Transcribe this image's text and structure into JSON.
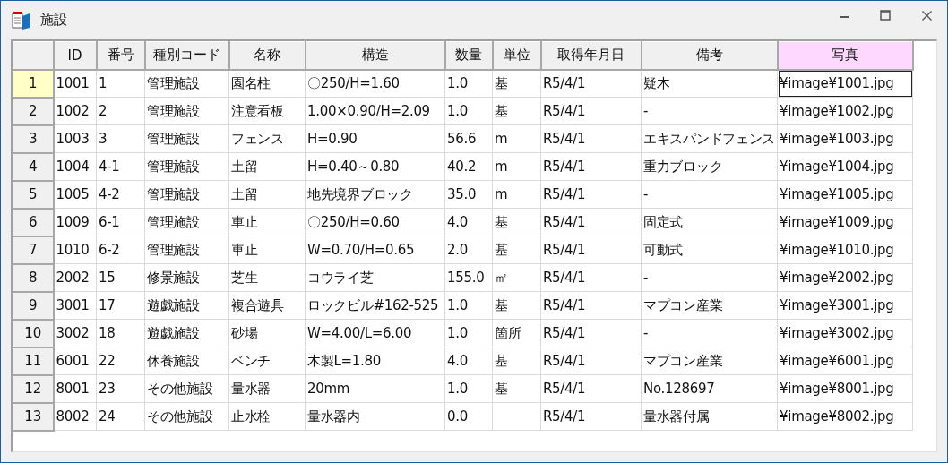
{
  "window": {
    "title": "施設"
  },
  "table": {
    "columns": [
      {
        "label": "ID",
        "selected": false
      },
      {
        "label": "番号",
        "selected": false
      },
      {
        "label": "種別コード",
        "selected": false
      },
      {
        "label": "名称",
        "selected": false
      },
      {
        "label": "構造",
        "selected": false
      },
      {
        "label": "数量",
        "selected": false
      },
      {
        "label": "単位",
        "selected": false
      },
      {
        "label": "取得年月日",
        "selected": false
      },
      {
        "label": "備考",
        "selected": false
      },
      {
        "label": "写真",
        "selected": true
      }
    ],
    "rows": [
      {
        "label": "1",
        "selected": true,
        "cells": [
          "1001",
          "1",
          "管理施設",
          "園名柱",
          "〇250/H=1.60",
          "1.0",
          "基",
          "R5/4/1",
          "疑木",
          "¥image¥1001.jpg"
        ]
      },
      {
        "label": "2",
        "selected": false,
        "cells": [
          "1002",
          "2",
          "管理施設",
          "注意看板",
          "1.00×0.90/H=2.09",
          "1.0",
          "基",
          "R5/4/1",
          "-",
          "¥image¥1002.jpg"
        ]
      },
      {
        "label": "3",
        "selected": false,
        "cells": [
          "1003",
          "3",
          "管理施設",
          "フェンス",
          "H=0.90",
          "56.6",
          "m",
          "R5/4/1",
          "エキスパンドフェンス",
          "¥image¥1003.jpg"
        ]
      },
      {
        "label": "4",
        "selected": false,
        "cells": [
          "1004",
          "4-1",
          "管理施設",
          "土留",
          "H=0.40～0.80",
          "40.2",
          "m",
          "R5/4/1",
          "重力ブロック",
          "¥image¥1004.jpg"
        ]
      },
      {
        "label": "5",
        "selected": false,
        "cells": [
          "1005",
          "4-2",
          "管理施設",
          "土留",
          "地先境界ブロック",
          "35.0",
          "m",
          "R5/4/1",
          "-",
          "¥image¥1005.jpg"
        ]
      },
      {
        "label": "6",
        "selected": false,
        "cells": [
          "1009",
          "6-1",
          "管理施設",
          "車止",
          "〇250/H=0.60",
          "4.0",
          "基",
          "R5/4/1",
          "固定式",
          "¥image¥1009.jpg"
        ]
      },
      {
        "label": "7",
        "selected": false,
        "cells": [
          "1010",
          "6-2",
          "管理施設",
          "車止",
          "W=0.70/H=0.65",
          "2.0",
          "基",
          "R5/4/1",
          "可動式",
          "¥image¥1010.jpg"
        ]
      },
      {
        "label": "8",
        "selected": false,
        "cells": [
          "2002",
          "15",
          "修景施設",
          "芝生",
          "コウライ芝",
          "155.0",
          "㎡",
          "R5/4/1",
          "-",
          "¥image¥2002.jpg"
        ]
      },
      {
        "label": "9",
        "selected": false,
        "cells": [
          "3001",
          "17",
          "遊戯施設",
          "複合遊具",
          "ロックビル#162-525",
          "1.0",
          "基",
          "R5/4/1",
          "マプコン産業",
          "¥image¥3001.jpg"
        ]
      },
      {
        "label": "10",
        "selected": false,
        "cells": [
          "3002",
          "18",
          "遊戯施設",
          "砂場",
          "W=4.00/L=6.00",
          "1.0",
          "箇所",
          "R5/4/1",
          "-",
          "¥image¥3002.jpg"
        ]
      },
      {
        "label": "11",
        "selected": false,
        "cells": [
          "6001",
          "22",
          "休養施設",
          "ベンチ",
          "木製L=1.80",
          "4.0",
          "基",
          "R5/4/1",
          "マプコン産業",
          "¥image¥6001.jpg"
        ]
      },
      {
        "label": "12",
        "selected": false,
        "cells": [
          "8001",
          "23",
          "その他施設",
          "量水器",
          "20mm",
          "1.0",
          "基",
          "R5/4/1",
          "No.128697",
          "¥image¥8001.jpg"
        ]
      },
      {
        "label": "13",
        "selected": false,
        "cells": [
          "8002",
          "24",
          "その他施設",
          "止水栓",
          "量水器内",
          "0.0",
          "",
          "R5/4/1",
          "量水器付属",
          "¥image¥8002.jpg"
        ]
      }
    ]
  }
}
